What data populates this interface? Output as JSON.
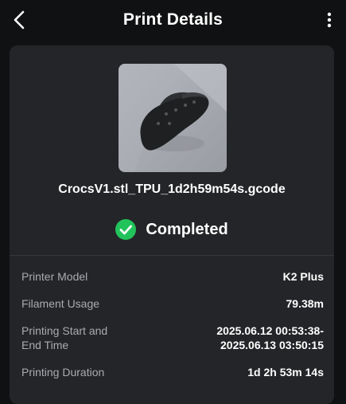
{
  "header": {
    "title": "Print Details"
  },
  "file": {
    "name": "CrocsV1.stl_TPU_1d2h59m54s.gcode"
  },
  "status": {
    "text": "Completed",
    "color": "#22c35b"
  },
  "details": {
    "printer_model": {
      "label": "Printer Model",
      "value": "K2 Plus"
    },
    "filament_usage": {
      "label": "Filament Usage",
      "value": "79.38m"
    },
    "time": {
      "label_line1": "Printing Start and",
      "label_line2": "End Time",
      "start": "2025.06.12 00:53:38-",
      "end": "2025.06.13 03:50:15"
    },
    "duration": {
      "label": "Printing Duration",
      "value": "1d 2h 53m 14s"
    }
  },
  "icons": [
    "back-arrow-icon",
    "more-vertical-icon",
    "check-circle-icon"
  ]
}
